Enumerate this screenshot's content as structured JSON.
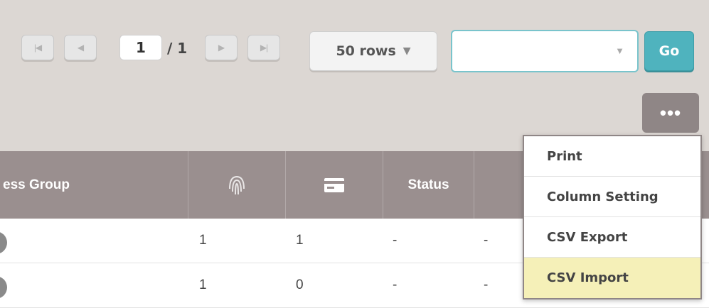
{
  "pagination": {
    "first_icon": "first-page-icon",
    "prev_icon": "prev-page-icon",
    "current_page": "1",
    "total_pages": "/ 1",
    "next_icon": "next-page-icon",
    "last_icon": "last-page-icon",
    "rows_label": "50 rows",
    "filter_value": "",
    "go_label": "Go"
  },
  "more_button": {
    "icon": "more-icon",
    "label": "•••"
  },
  "table": {
    "columns": [
      {
        "label": "ess Group"
      },
      {
        "icon": "fingerprint-icon"
      },
      {
        "icon": "card-icon"
      },
      {
        "label": "Status"
      },
      {
        "label": ""
      }
    ],
    "rows": [
      {
        "fingerprint": "1",
        "card": "1",
        "status": "-",
        "extra": "-"
      },
      {
        "fingerprint": "1",
        "card": "0",
        "status": "-",
        "extra": "-"
      }
    ]
  },
  "menu": {
    "items": [
      {
        "label": "Print",
        "active": false
      },
      {
        "label": "Column Setting",
        "active": false
      },
      {
        "label": "CSV Export",
        "active": false
      },
      {
        "label": "CSV Import",
        "active": true
      }
    ]
  },
  "colors": {
    "background": "#dcd7d3",
    "header": "#9a8f8f",
    "go_button": "#4fb3be",
    "select_border": "#79c4cc",
    "menu_highlight": "#f5f0b8"
  }
}
